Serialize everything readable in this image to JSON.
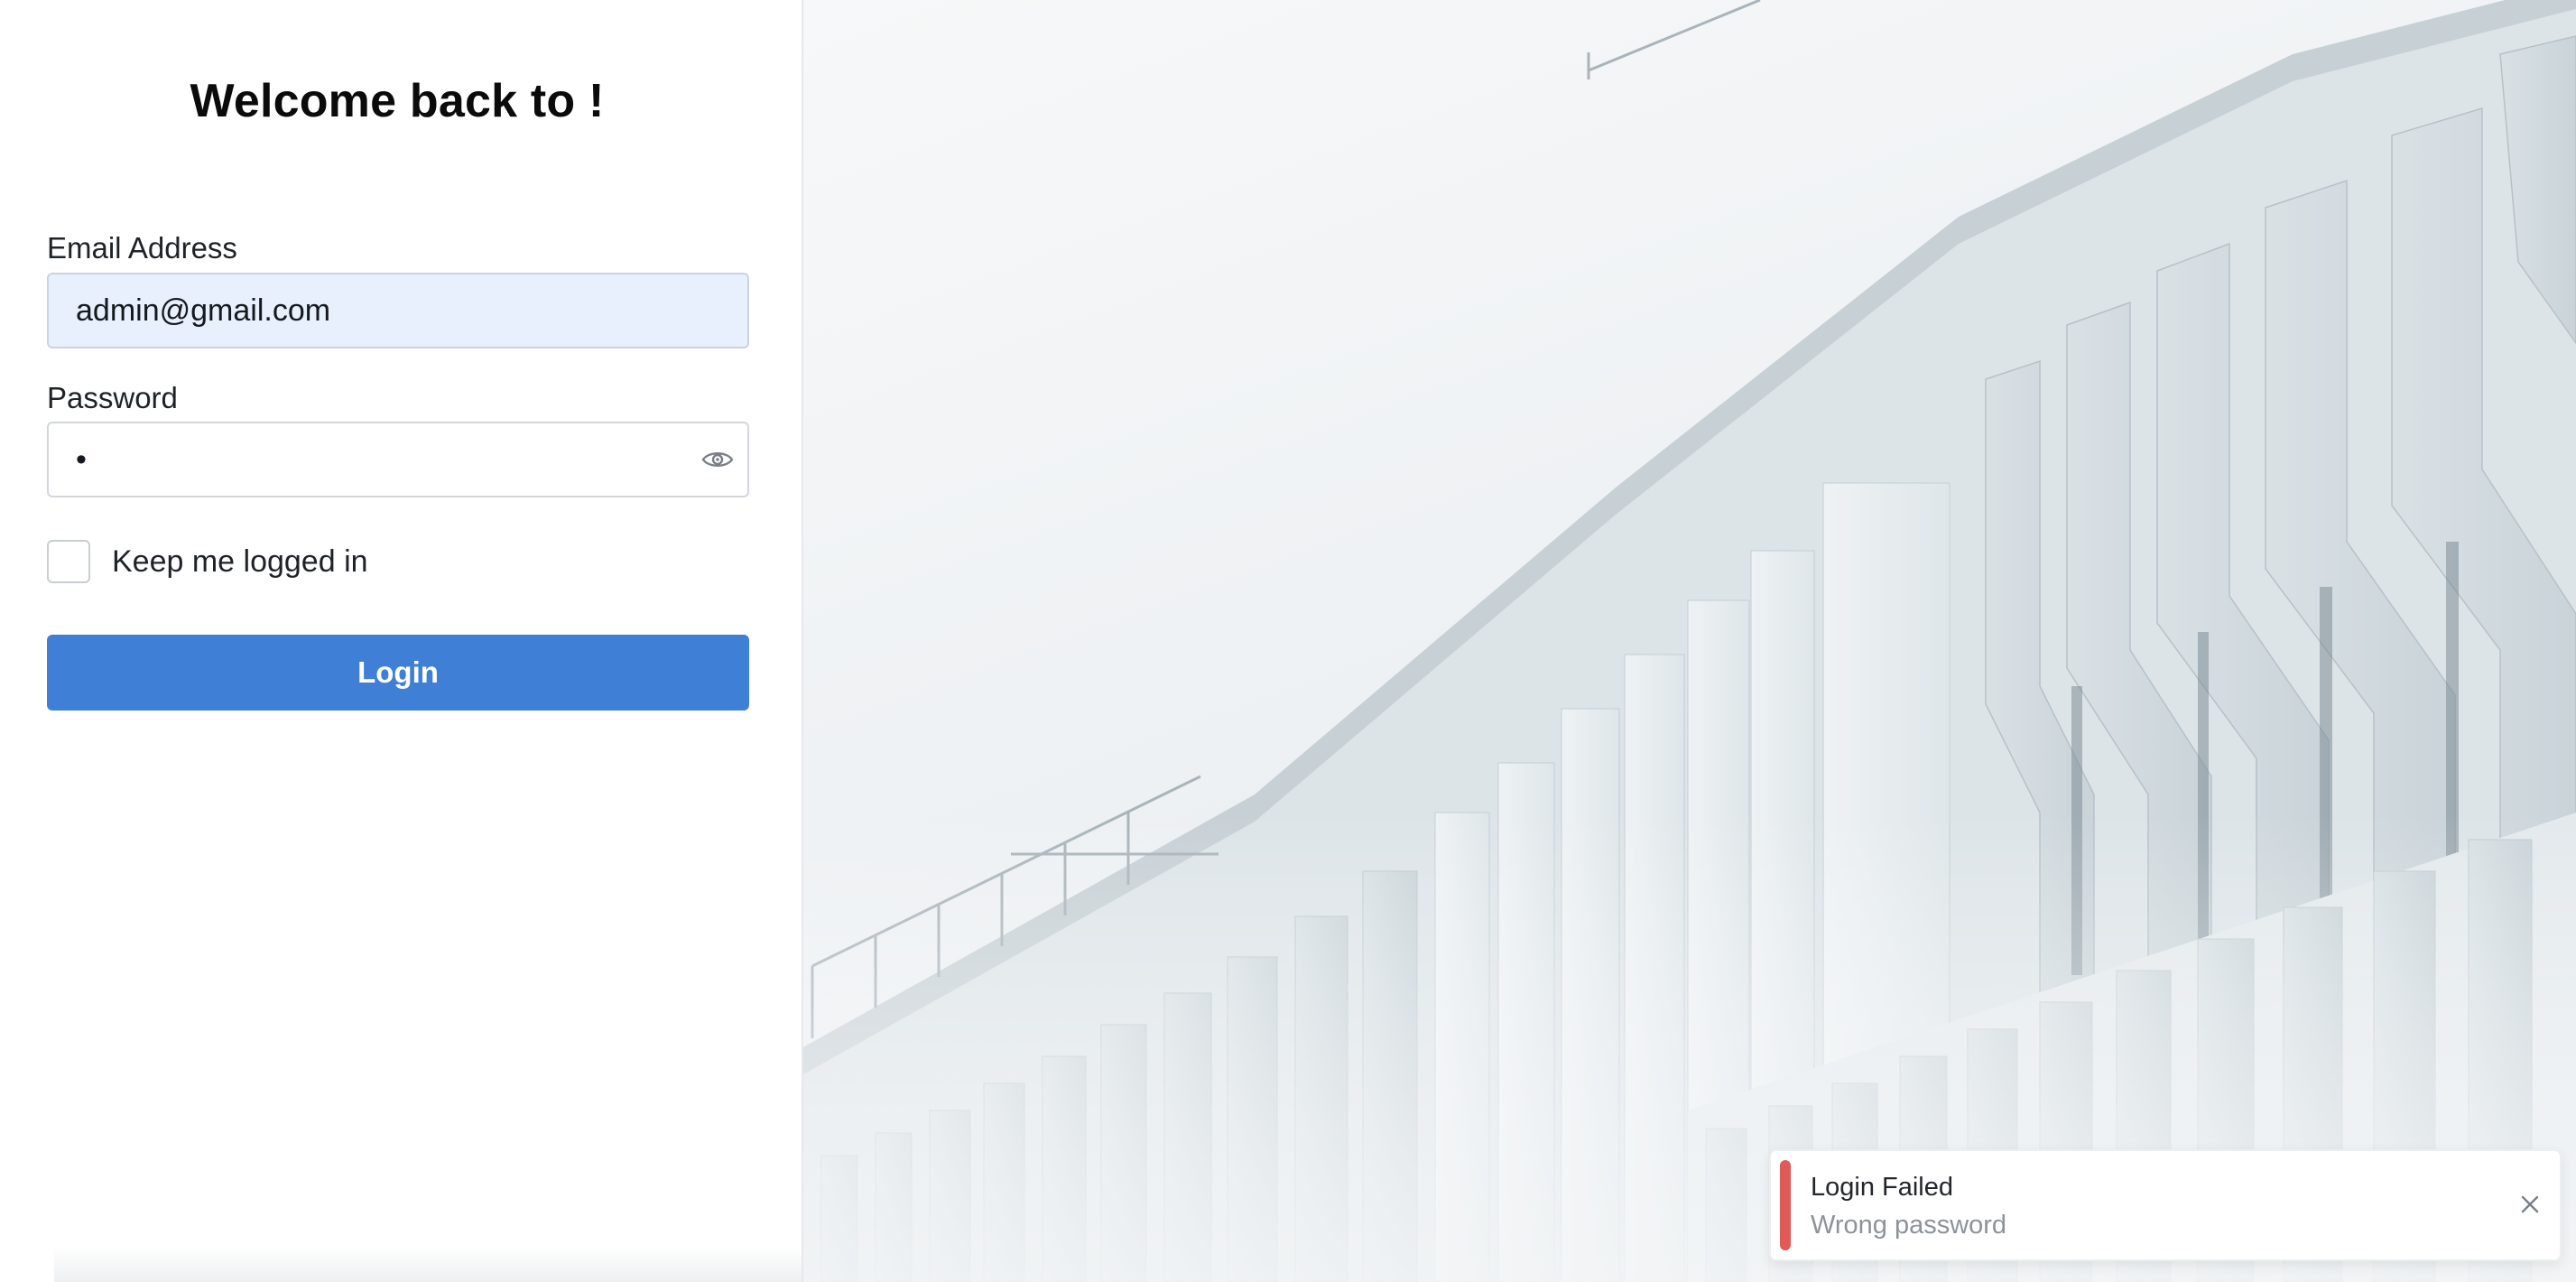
{
  "login": {
    "title": "Welcome back to !",
    "email_label": "Email Address",
    "email_value": "admin@gmail.com",
    "password_label": "Password",
    "password_value": "1",
    "remember_label": "Keep me logged in",
    "remember_checked": false,
    "submit_label": "Login"
  },
  "icons": {
    "password_toggle": "eye-icon",
    "toast_close": "close-icon"
  },
  "toast": {
    "title": "Login Failed",
    "message": "Wrong password",
    "accent_color": "#e05a5a"
  },
  "colors": {
    "primary_button": "#3f7fd6",
    "autofill_input": "#e8f0fe"
  }
}
